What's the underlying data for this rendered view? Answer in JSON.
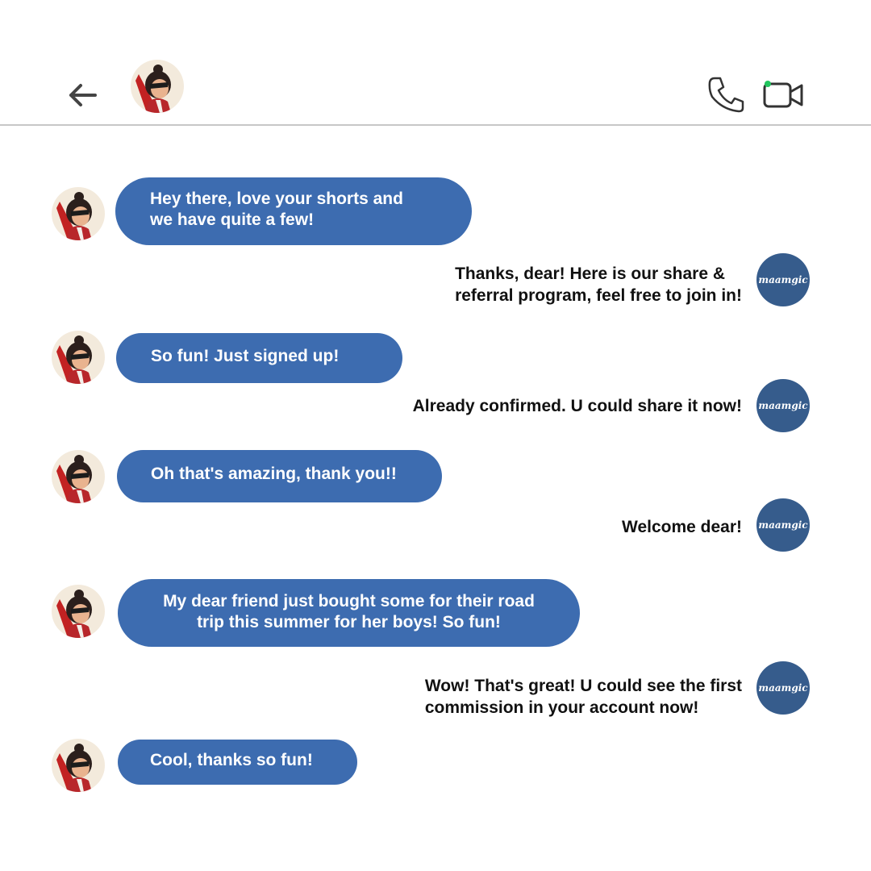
{
  "header": {
    "back_icon": "arrow-left-icon",
    "contact_avatar": "character-avatar",
    "call_icon": "phone-icon",
    "video_icon": "video-camera-icon",
    "online_status_color": "#22c55e"
  },
  "brand": {
    "logo_text": "maamgic",
    "avatar_color": "#365c8c"
  },
  "colors": {
    "incoming_bubble": "#3d6cb0",
    "divider": "#c7c7c7"
  },
  "messages": [
    {
      "from": "contact",
      "text": "Hey there, love your shorts and\nwe have quite a few!"
    },
    {
      "from": "brand",
      "text": "Thanks, dear! Here is our share &\nreferral program, feel free to join in!"
    },
    {
      "from": "contact",
      "text": "So fun! Just signed up!"
    },
    {
      "from": "brand",
      "text": "Already confirmed. U could share it now!"
    },
    {
      "from": "contact",
      "text": "Oh that's amazing, thank you!!"
    },
    {
      "from": "brand",
      "text": "Welcome dear!"
    },
    {
      "from": "contact",
      "text": "My dear friend just bought some for their road\ntrip this summer for her boys! So fun!"
    },
    {
      "from": "brand",
      "text": "Wow! That's great! U could see the first\ncommission in your account now!"
    },
    {
      "from": "contact",
      "text": "Cool, thanks so fun!"
    }
  ]
}
